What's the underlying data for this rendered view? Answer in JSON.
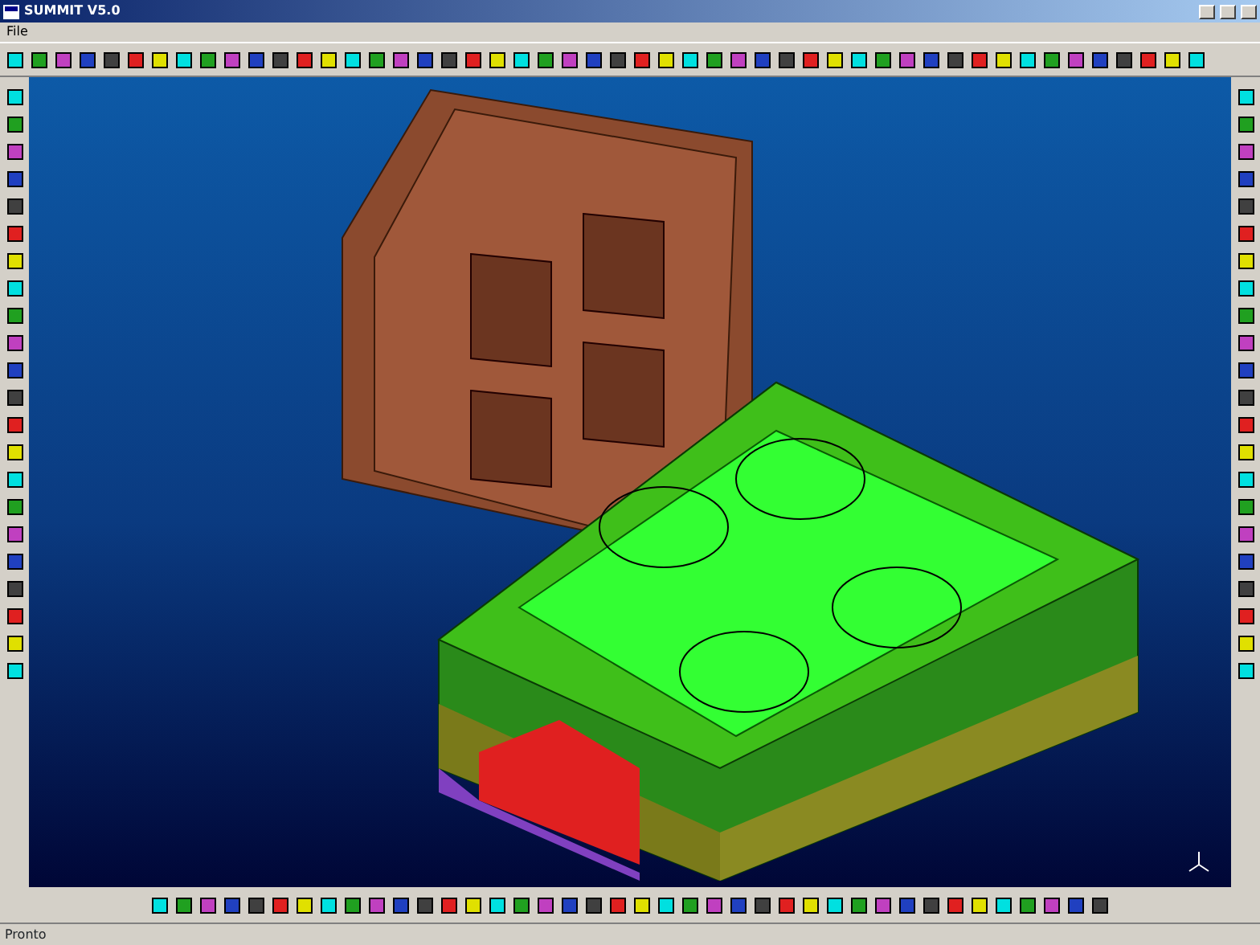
{
  "window": {
    "title": "SUMMIT V5.0"
  },
  "menu": [
    {
      "label": "File"
    }
  ],
  "status_bar": {
    "text": "Pronto"
  }
}
